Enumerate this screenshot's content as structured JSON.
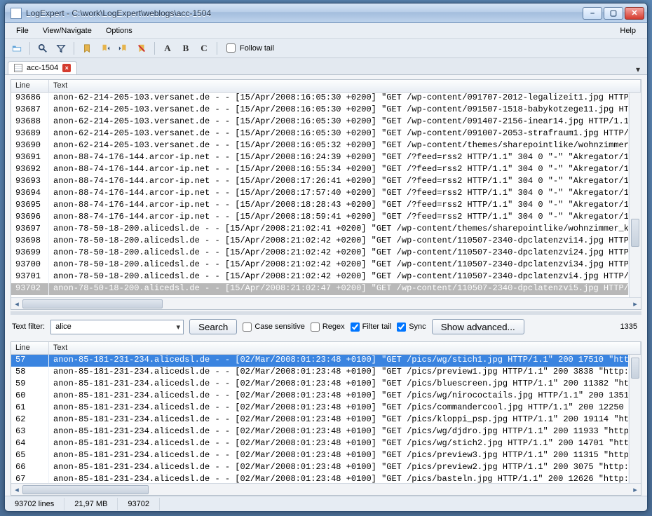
{
  "window": {
    "title": "LogExpert - C:\\work\\LogExpert\\weblogs\\acc-1504"
  },
  "menu": {
    "file": "File",
    "view": "View/Navigate",
    "options": "Options",
    "help": "Help"
  },
  "toolbar": {
    "a": "A",
    "b": "B",
    "c": "C",
    "follow": "Follow tail"
  },
  "tabs": [
    {
      "label": "acc-1504"
    }
  ],
  "columns": {
    "line": "Line",
    "text": "Text"
  },
  "main_rows": [
    {
      "line": "93686",
      "text": "anon-62-214-205-103.versanet.de - - [15/Apr/2008:16:05:30 +0200] \"GET /wp-content/091707-2012-legalizeit1.jpg HTTP/1"
    },
    {
      "line": "93687",
      "text": "anon-62-214-205-103.versanet.de - - [15/Apr/2008:16:05:30 +0200] \"GET /wp-content/091507-1518-babykotzege11.jpg HTTP/"
    },
    {
      "line": "93688",
      "text": "anon-62-214-205-103.versanet.de - - [15/Apr/2008:16:05:30 +0200] \"GET /wp-content/091407-2156-inear14.jpg HTTP/1.1\" 2"
    },
    {
      "line": "93689",
      "text": "anon-62-214-205-103.versanet.de - - [15/Apr/2008:16:05:30 +0200] \"GET /wp-content/091007-2053-strafraum1.jpg HTTP/1.1"
    },
    {
      "line": "93690",
      "text": "anon-62-214-205-103.versanet.de - - [15/Apr/2008:16:05:32 +0200] \"GET /wp-content/themes/sharepointlike/wohnzimmer_kl"
    },
    {
      "line": "93691",
      "text": "anon-88-74-176-144.arcor-ip.net - - [15/Apr/2008:16:24:39 +0200] \"GET /?feed=rss2 HTTP/1.1\" 304 0 \"-\" \"Akregator/1.2."
    },
    {
      "line": "93692",
      "text": "anon-88-74-176-144.arcor-ip.net - - [15/Apr/2008:16:55:34 +0200] \"GET /?feed=rss2 HTTP/1.1\" 304 0 \"-\" \"Akregator/1.2."
    },
    {
      "line": "93693",
      "text": "anon-88-74-176-144.arcor-ip.net - - [15/Apr/2008:17:26:41 +0200] \"GET /?feed=rss2 HTTP/1.1\" 304 0 \"-\" \"Akregator/1.2."
    },
    {
      "line": "93694",
      "text": "anon-88-74-176-144.arcor-ip.net - - [15/Apr/2008:17:57:40 +0200] \"GET /?feed=rss2 HTTP/1.1\" 304 0 \"-\" \"Akregator/1.2."
    },
    {
      "line": "93695",
      "text": "anon-88-74-176-144.arcor-ip.net - - [15/Apr/2008:18:28:43 +0200] \"GET /?feed=rss2 HTTP/1.1\" 304 0 \"-\" \"Akregator/1.2."
    },
    {
      "line": "93696",
      "text": "anon-88-74-176-144.arcor-ip.net - - [15/Apr/2008:18:59:41 +0200] \"GET /?feed=rss2 HTTP/1.1\" 304 0 \"-\" \"Akregator/1.2."
    },
    {
      "line": "93697",
      "text": "anon-78-50-18-200.alicedsl.de - - [15/Apr/2008:21:02:41 +0200] \"GET /wp-content/themes/sharepointlike/wohnzimmer_klei"
    },
    {
      "line": "93698",
      "text": "anon-78-50-18-200.alicedsl.de - - [15/Apr/2008:21:02:42 +0200] \"GET /wp-content/110507-2340-dpclatenzvi14.jpg HTTP/1."
    },
    {
      "line": "93699",
      "text": "anon-78-50-18-200.alicedsl.de - - [15/Apr/2008:21:02:42 +0200] \"GET /wp-content/110507-2340-dpclatenzvi24.jpg HTTP/1."
    },
    {
      "line": "93700",
      "text": "anon-78-50-18-200.alicedsl.de - - [15/Apr/2008:21:02:42 +0200] \"GET /wp-content/110507-2340-dpclatenzvi34.jpg HTTP/1."
    },
    {
      "line": "93701",
      "text": "anon-78-50-18-200.alicedsl.de - - [15/Apr/2008:21:02:42 +0200] \"GET /wp-content/110507-2340-dpclatenzvi4.jpg HTTP/1.1"
    },
    {
      "line": "93702",
      "text": "anon-78-50-18-200.alicedsl.de - - [15/Apr/2008:21:02:47 +0200] \"GET /wp-content/110507-2340-dpclatenzvi5.jpg HTTP/1.1",
      "sel": "grey"
    }
  ],
  "filter": {
    "label": "Text filter:",
    "value": "alice",
    "search_btn": "Search",
    "case": "Case sensitive",
    "regex": "Regex",
    "tail": "Filter tail",
    "sync": "Sync",
    "advanced_btn": "Show advanced...",
    "result_count": "1335"
  },
  "filter_rows": [
    {
      "line": "57",
      "text": "anon-85-181-231-234.alicedsl.de - - [02/Mar/2008:01:23:48 +0100] \"GET /pics/wg/stich1.jpg HTTP/1.1\" 200 17510 \"http:",
      "sel": "blue"
    },
    {
      "line": "58",
      "text": "anon-85-181-231-234.alicedsl.de - - [02/Mar/2008:01:23:48 +0100] \"GET /pics/preview1.jpg HTTP/1.1\" 200 3838 \"http://"
    },
    {
      "line": "59",
      "text": "anon-85-181-231-234.alicedsl.de - - [02/Mar/2008:01:23:48 +0100] \"GET /pics/bluescreen.jpg HTTP/1.1\" 200 11382 \"http"
    },
    {
      "line": "60",
      "text": "anon-85-181-231-234.alicedsl.de - - [02/Mar/2008:01:23:48 +0100] \"GET /pics/wg/nirococtails.jpg HTTP/1.1\" 200 13519"
    },
    {
      "line": "61",
      "text": "anon-85-181-231-234.alicedsl.de - - [02/Mar/2008:01:23:48 +0100] \"GET /pics/commandercool.jpg HTTP/1.1\" 200 12250 \"h"
    },
    {
      "line": "62",
      "text": "anon-85-181-231-234.alicedsl.de - - [02/Mar/2008:01:23:48 +0100] \"GET /pics/kloppi_psp.jpg HTTP/1.1\" 200 19114 \"http"
    },
    {
      "line": "63",
      "text": "anon-85-181-231-234.alicedsl.de - - [02/Mar/2008:01:23:48 +0100] \"GET /pics/wg/djdro.jpg HTTP/1.1\" 200 11933 \"http:/"
    },
    {
      "line": "64",
      "text": "anon-85-181-231-234.alicedsl.de - - [02/Mar/2008:01:23:48 +0100] \"GET /pics/wg/stich2.jpg HTTP/1.1\" 200 14701 \"http:"
    },
    {
      "line": "65",
      "text": "anon-85-181-231-234.alicedsl.de - - [02/Mar/2008:01:23:48 +0100] \"GET /pics/preview3.jpg HTTP/1.1\" 200 11315 \"http:/"
    },
    {
      "line": "66",
      "text": "anon-85-181-231-234.alicedsl.de - - [02/Mar/2008:01:23:48 +0100] \"GET /pics/preview2.jpg HTTP/1.1\" 200 3075 \"http://"
    },
    {
      "line": "67",
      "text": "anon-85-181-231-234.alicedsl.de - - [02/Mar/2008:01:23:48 +0100] \"GET /pics/basteln.jpg HTTP/1.1\" 200 12626 \"http://"
    }
  ],
  "status": {
    "lines": "93702 lines",
    "size": "21,97 MB",
    "current": "93702"
  }
}
